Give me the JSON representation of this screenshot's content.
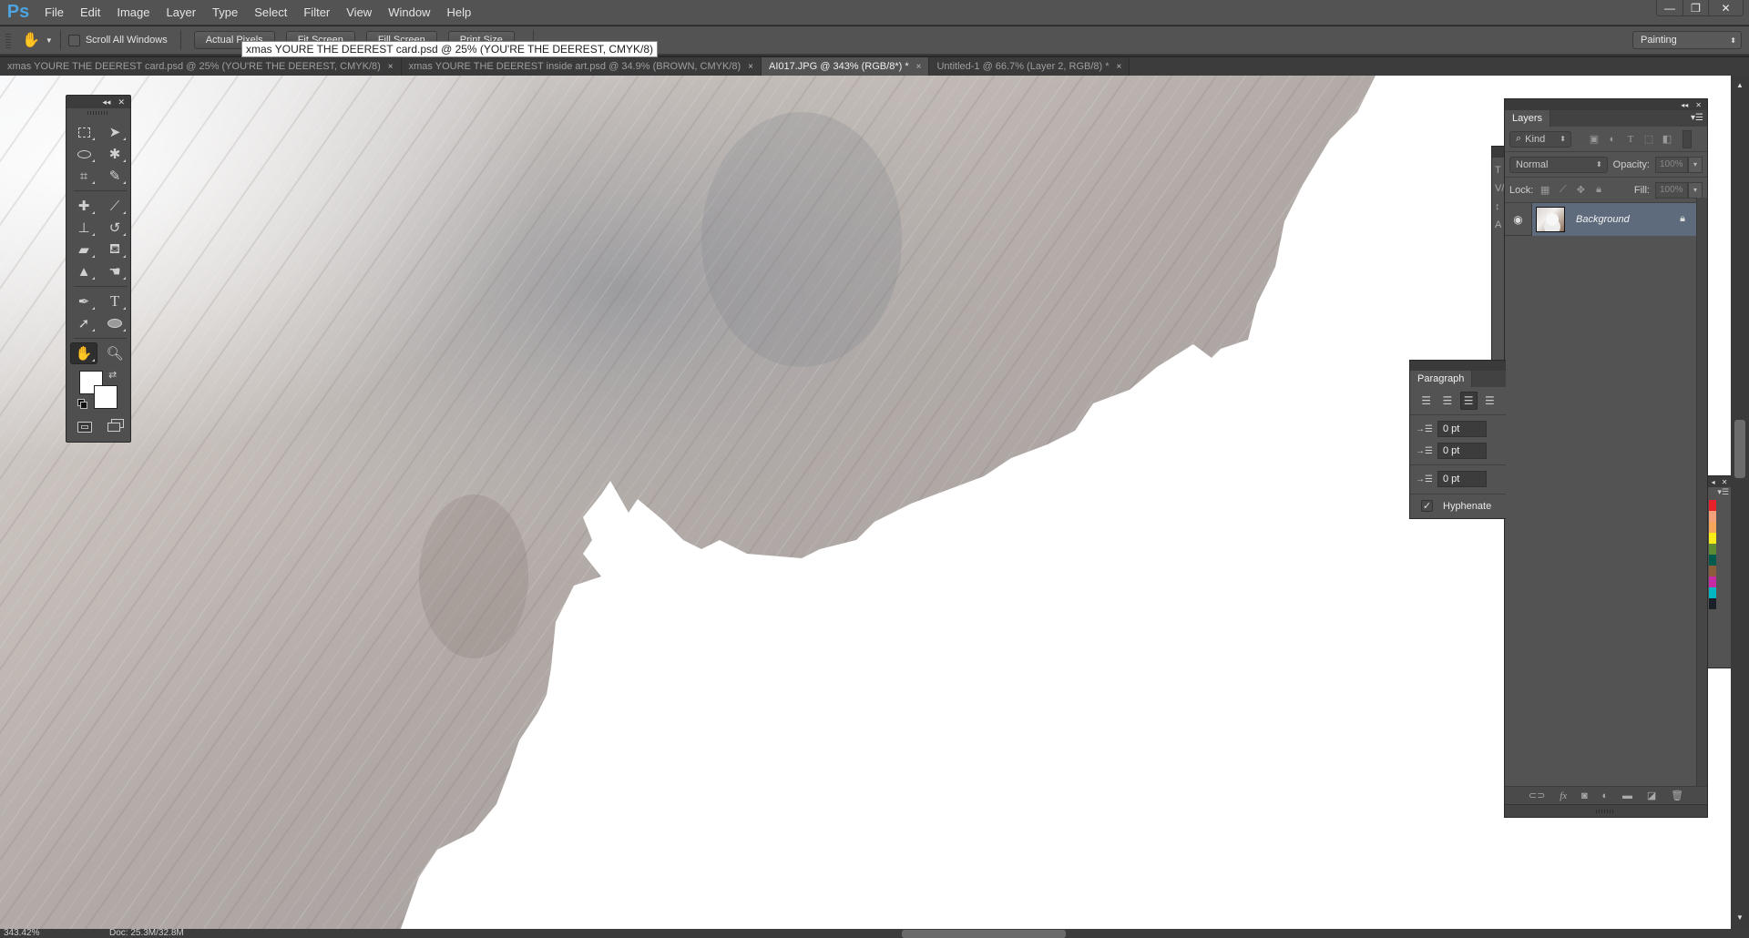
{
  "app": {
    "logo": "Ps",
    "menu": [
      "File",
      "Edit",
      "Image",
      "Layer",
      "Type",
      "Select",
      "Filter",
      "View",
      "Window",
      "Help"
    ],
    "window_controls": {
      "minimize": "—",
      "restore": "❐",
      "close": "✕"
    }
  },
  "options_bar": {
    "tool_icon": "hand-icon",
    "scroll_all_windows_label": "Scroll All Windows",
    "scroll_all_windows_checked": false,
    "buttons": [
      "Actual Pixels",
      "Fit Screen",
      "Fill Screen",
      "Print Size"
    ],
    "workspace": "Painting"
  },
  "tooltip": "xmas YOURE THE DEEREST card.psd @ 25% (YOU'RE  THE  DEEREST, CMYK/8)",
  "tabs": [
    {
      "label": "xmas YOURE THE DEEREST card.psd @ 25% (YOU'RE  THE  DEEREST, CMYK/8)",
      "active": false
    },
    {
      "label": "xmas YOURE THE DEEREST inside art.psd @ 34.9% (BROWN, CMYK/8)",
      "active": false
    },
    {
      "label": "AI017.JPG @ 343% (RGB/8*) *",
      "active": true
    },
    {
      "label": "Untitled-1 @ 66.7% (Layer 2, RGB/8) *",
      "active": false
    }
  ],
  "tab_close": "×",
  "tools": [
    "rectangular-marquee",
    "move",
    "lasso",
    "magic-wand",
    "crop",
    "eyedropper",
    "spot-healing-brush",
    "brush",
    "clone-stamp",
    "history-brush",
    "eraser",
    "paint-bucket",
    "sharpen",
    "smudge",
    "pen",
    "type",
    "path-selection",
    "ellipse",
    "hand",
    "zoom"
  ],
  "active_tool": "hand",
  "colors": {
    "foreground": "#ffffff",
    "background": "#ffffff",
    "accent_selection": "#5d6b7d",
    "ps_logo": "#4da3e0"
  },
  "layers_panel": {
    "title": "Layers",
    "filter_kind": "Kind",
    "blend_mode": "Normal",
    "opacity_label": "Opacity:",
    "opacity_value": "100%",
    "lock_label": "Lock:",
    "fill_label": "Fill:",
    "fill_value": "100%",
    "layers": [
      {
        "name": "Background",
        "visible": true,
        "locked": true,
        "selected": true
      }
    ],
    "footer_icons": [
      "link-icon",
      "fx-icon",
      "mask-icon",
      "adjustment-icon",
      "folder-icon",
      "new-layer-icon",
      "trash-icon"
    ]
  },
  "paragraph_panel": {
    "title": "Paragraph",
    "alignment_active": "right",
    "indent_left": "0 pt",
    "indent_first_line": "0 pt",
    "space_before": "0 pt",
    "hyphenate_label": "Hyphenate",
    "hyphenate_checked": true
  },
  "swatches": [
    "#e8202a",
    "#f2a07a",
    "#f5a65b",
    "#f7ec16",
    "#5d8a33",
    "#005b4e",
    "#8c5d3a",
    "#c72aa5",
    "#00b7c3",
    "#1b1f27"
  ],
  "status_bar": {
    "zoom": "343.42%",
    "doc_size": "Doc: 25.3M/32.8M"
  }
}
